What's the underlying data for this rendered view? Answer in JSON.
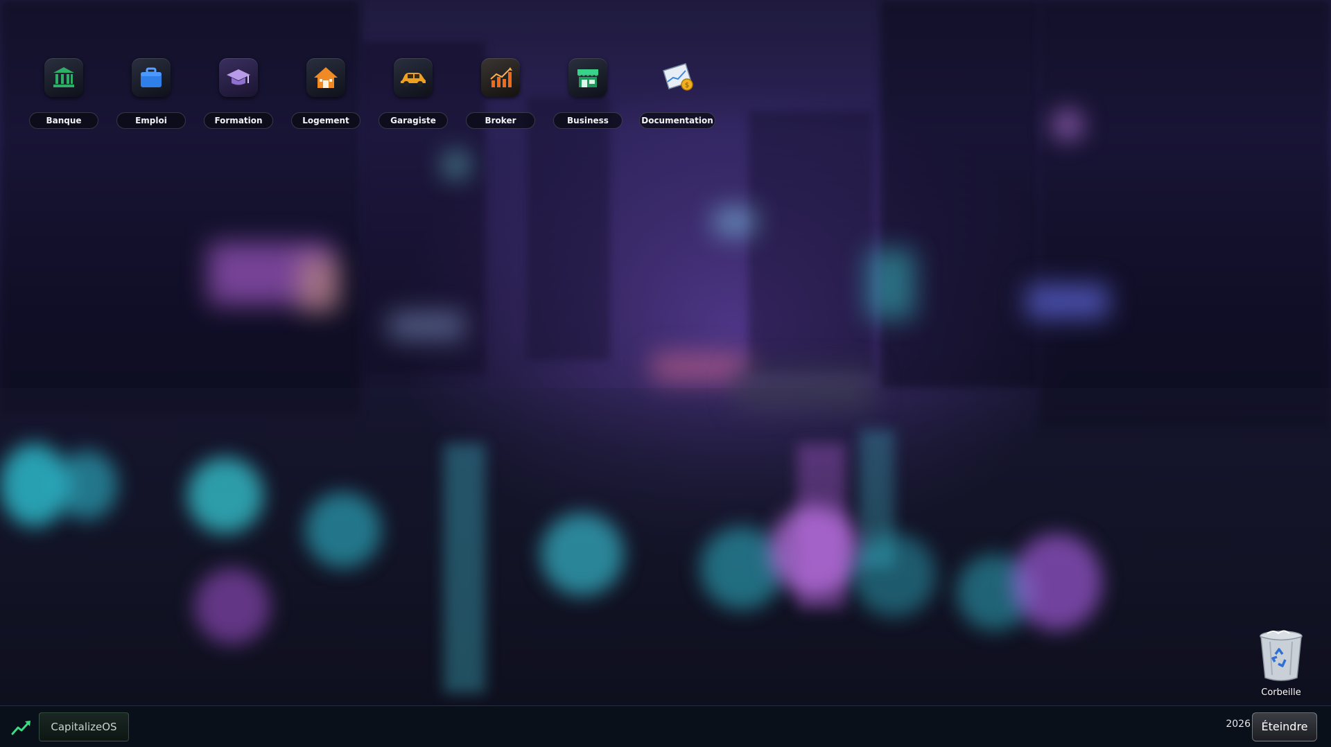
{
  "desktop": {
    "icons": [
      {
        "label": "Banque",
        "icon": "bank-icon"
      },
      {
        "label": "Emploi",
        "icon": "briefcase-icon"
      },
      {
        "label": "Formation",
        "icon": "graduation-cap-icon"
      },
      {
        "label": "Logement",
        "icon": "house-icon"
      },
      {
        "label": "Garagiste",
        "icon": "car-icon"
      },
      {
        "label": "Broker",
        "icon": "stock-chart-icon"
      },
      {
        "label": "Business",
        "icon": "storefront-icon"
      },
      {
        "label": "Documentation",
        "icon": "document-chart-icon"
      }
    ],
    "recycle_bin": {
      "label": "Corbeille",
      "icon": "recycle-bin-icon"
    }
  },
  "taskbar": {
    "start_label": "CapitalizeOS",
    "start_icon": "trend-up-icon",
    "year": "2026",
    "shutdown_label": "Éteindre"
  },
  "colors": {
    "accent_green": "#3ddc84",
    "taskbar_bg": "#0a101a",
    "neon_cyan": "#2fd6e6",
    "neon_purple": "#b56cf0"
  }
}
